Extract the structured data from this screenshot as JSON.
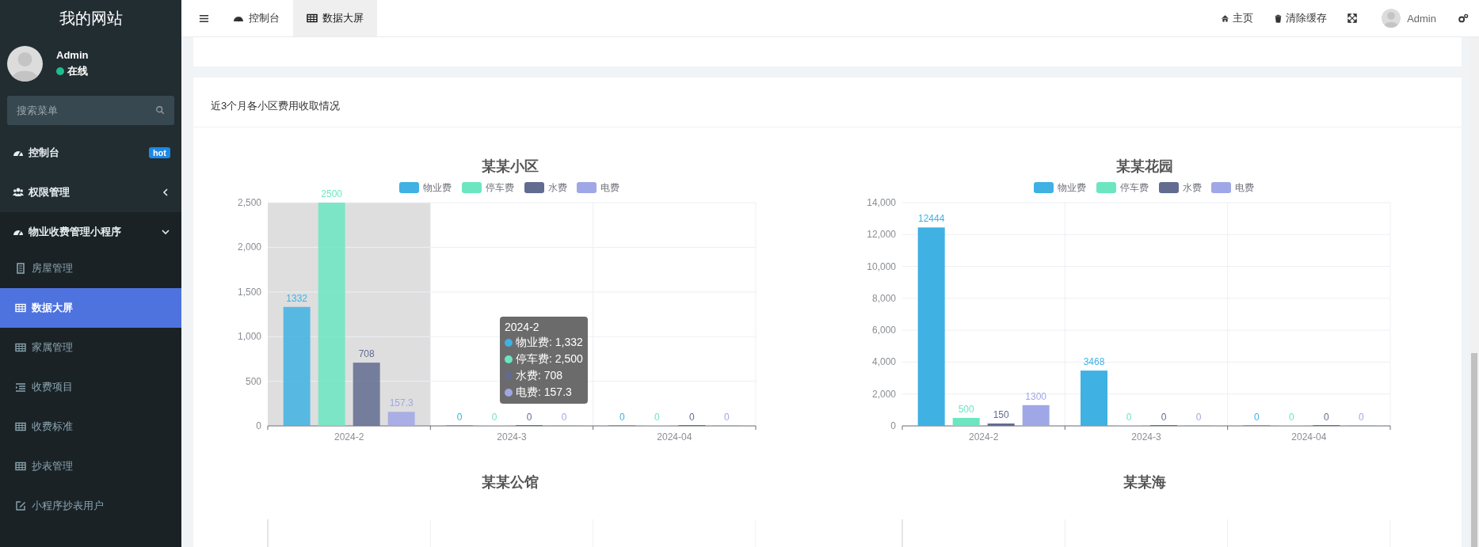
{
  "sidebar": {
    "title": "我的网站",
    "user": {
      "name": "Admin",
      "status": "在线",
      "online": true
    },
    "search": {
      "placeholder": "搜索菜单"
    },
    "items": [
      {
        "label": "控制台",
        "kind": "badge",
        "badge": "hot",
        "selected": false
      },
      {
        "label": "权限管理",
        "kind": "group",
        "expanded": false,
        "selected": false
      },
      {
        "label": "物业收费管理小程序",
        "kind": "group",
        "expanded": true,
        "selected": false,
        "children": [
          {
            "label": "房屋管理",
            "selected": false
          },
          {
            "label": "数据大屏",
            "selected": true
          },
          {
            "label": "家属管理",
            "selected": false
          },
          {
            "label": "收费项目",
            "selected": false
          },
          {
            "label": "收费标准",
            "selected": false
          },
          {
            "label": "抄表管理",
            "selected": false
          },
          {
            "label": "小程序抄表用户",
            "selected": false
          }
        ]
      }
    ]
  },
  "topbar": {
    "tabs": [
      {
        "label": "控制台",
        "selected": false
      },
      {
        "label": "数据大屏",
        "selected": true
      }
    ],
    "actions": [
      {
        "label": "主页"
      },
      {
        "label": "清除缓存"
      }
    ],
    "user": "Admin"
  },
  "panel": {
    "title": "近3个月各小区费用收取情况",
    "charts": [
      {
        "columns": [
          {
            "hovered": true
          },
          {
            "hovered": false
          },
          {
            "hovered": false
          }
        ],
        "tooltip": {
          "title": "2024-2",
          "rows": [
            {
              "label": "物业费: 1,332",
              "color": "#3fb1e3"
            },
            {
              "label": "停车费: 2,500",
              "color": "#6be6c1"
            },
            {
              "label": "水费: 708",
              "color": "#626c91"
            },
            {
              "label": "电费: 157.3",
              "color": "#a0a7e6"
            }
          ]
        },
        "chart_data": {
          "type": "bar",
          "title": "某某小区",
          "grid": true,
          "legend": true,
          "categories": [
            "2024-2",
            "2024-3",
            "2024-04"
          ],
          "ylim": [
            0,
            2500
          ],
          "yticks": [
            {
              "value": 0,
              "label": "0"
            },
            {
              "value": 500,
              "label": "500"
            },
            {
              "value": 1000,
              "label": "1,000"
            },
            {
              "value": 1500,
              "label": "1,500"
            },
            {
              "value": 2000,
              "label": "2,000"
            },
            {
              "value": 2500,
              "label": "2,500"
            }
          ],
          "data_labels": true,
          "series": [
            {
              "name": "物业费",
              "color": "#3fb1e3",
              "values": [
                1332,
                0,
                0
              ]
            },
            {
              "name": "停车费",
              "color": "#6be6c1",
              "values": [
                2500,
                0,
                0
              ]
            },
            {
              "name": "水费",
              "color": "#626c91",
              "values": [
                708,
                0,
                0
              ]
            },
            {
              "name": "电费",
              "color": "#a0a7e6",
              "values": [
                157.3,
                0,
                0
              ]
            }
          ]
        }
      },
      {
        "columns": [
          {
            "hovered": false
          },
          {
            "hovered": false
          },
          {
            "hovered": false
          }
        ],
        "chart_data": {
          "type": "bar",
          "title": "某某花园",
          "grid": true,
          "legend": true,
          "categories": [
            "2024-2",
            "2024-3",
            "2024-04"
          ],
          "ylim": [
            0,
            14000
          ],
          "yticks": [
            {
              "value": 0,
              "label": "0"
            },
            {
              "value": 2000,
              "label": "2,000"
            },
            {
              "value": 4000,
              "label": "4,000"
            },
            {
              "value": 6000,
              "label": "6,000"
            },
            {
              "value": 8000,
              "label": "8,000"
            },
            {
              "value": 10000,
              "label": "10,000"
            },
            {
              "value": 12000,
              "label": "12,000"
            },
            {
              "value": 14000,
              "label": "14,000"
            }
          ],
          "data_labels": true,
          "series": [
            {
              "name": "物业费",
              "color": "#3fb1e3",
              "values": [
                12444,
                3468,
                0
              ]
            },
            {
              "name": "停车费",
              "color": "#6be6c1",
              "values": [
                500,
                0,
                0
              ]
            },
            {
              "name": "水费",
              "color": "#626c91",
              "values": [
                150,
                0,
                0
              ]
            },
            {
              "name": "电费",
              "color": "#a0a7e6",
              "values": [
                1300,
                0,
                0
              ]
            }
          ]
        }
      }
    ],
    "more_charts": [
      {
        "title": "某某公馆"
      },
      {
        "title": "某某海"
      }
    ]
  }
}
